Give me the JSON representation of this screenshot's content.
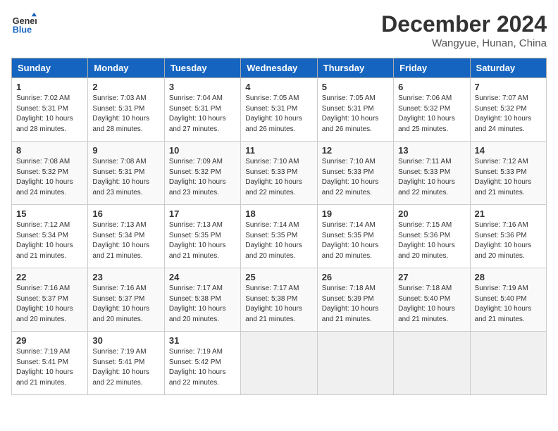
{
  "header": {
    "logo_general": "General",
    "logo_blue": "Blue",
    "month_title": "December 2024",
    "subtitle": "Wangyue, Hunan, China"
  },
  "weekdays": [
    "Sunday",
    "Monday",
    "Tuesday",
    "Wednesday",
    "Thursday",
    "Friday",
    "Saturday"
  ],
  "weeks": [
    [
      {
        "day": "1",
        "sunrise": "7:02 AM",
        "sunset": "5:31 PM",
        "daylight": "10 hours and 28 minutes."
      },
      {
        "day": "2",
        "sunrise": "7:03 AM",
        "sunset": "5:31 PM",
        "daylight": "10 hours and 28 minutes."
      },
      {
        "day": "3",
        "sunrise": "7:04 AM",
        "sunset": "5:31 PM",
        "daylight": "10 hours and 27 minutes."
      },
      {
        "day": "4",
        "sunrise": "7:05 AM",
        "sunset": "5:31 PM",
        "daylight": "10 hours and 26 minutes."
      },
      {
        "day": "5",
        "sunrise": "7:05 AM",
        "sunset": "5:31 PM",
        "daylight": "10 hours and 26 minutes."
      },
      {
        "day": "6",
        "sunrise": "7:06 AM",
        "sunset": "5:32 PM",
        "daylight": "10 hours and 25 minutes."
      },
      {
        "day": "7",
        "sunrise": "7:07 AM",
        "sunset": "5:32 PM",
        "daylight": "10 hours and 24 minutes."
      }
    ],
    [
      {
        "day": "8",
        "sunrise": "7:08 AM",
        "sunset": "5:32 PM",
        "daylight": "10 hours and 24 minutes."
      },
      {
        "day": "9",
        "sunrise": "7:08 AM",
        "sunset": "5:31 PM",
        "daylight": "10 hours and 23 minutes."
      },
      {
        "day": "10",
        "sunrise": "7:09 AM",
        "sunset": "5:32 PM",
        "daylight": "10 hours and 23 minutes."
      },
      {
        "day": "11",
        "sunrise": "7:10 AM",
        "sunset": "5:33 PM",
        "daylight": "10 hours and 22 minutes."
      },
      {
        "day": "12",
        "sunrise": "7:10 AM",
        "sunset": "5:33 PM",
        "daylight": "10 hours and 22 minutes."
      },
      {
        "day": "13",
        "sunrise": "7:11 AM",
        "sunset": "5:33 PM",
        "daylight": "10 hours and 22 minutes."
      },
      {
        "day": "14",
        "sunrise": "7:12 AM",
        "sunset": "5:33 PM",
        "daylight": "10 hours and 21 minutes."
      }
    ],
    [
      {
        "day": "15",
        "sunrise": "7:12 AM",
        "sunset": "5:34 PM",
        "daylight": "10 hours and 21 minutes."
      },
      {
        "day": "16",
        "sunrise": "7:13 AM",
        "sunset": "5:34 PM",
        "daylight": "10 hours and 21 minutes."
      },
      {
        "day": "17",
        "sunrise": "7:13 AM",
        "sunset": "5:35 PM",
        "daylight": "10 hours and 21 minutes."
      },
      {
        "day": "18",
        "sunrise": "7:14 AM",
        "sunset": "5:35 PM",
        "daylight": "10 hours and 20 minutes."
      },
      {
        "day": "19",
        "sunrise": "7:14 AM",
        "sunset": "5:35 PM",
        "daylight": "10 hours and 20 minutes."
      },
      {
        "day": "20",
        "sunrise": "7:15 AM",
        "sunset": "5:36 PM",
        "daylight": "10 hours and 20 minutes."
      },
      {
        "day": "21",
        "sunrise": "7:16 AM",
        "sunset": "5:36 PM",
        "daylight": "10 hours and 20 minutes."
      }
    ],
    [
      {
        "day": "22",
        "sunrise": "7:16 AM",
        "sunset": "5:37 PM",
        "daylight": "10 hours and 20 minutes."
      },
      {
        "day": "23",
        "sunrise": "7:16 AM",
        "sunset": "5:37 PM",
        "daylight": "10 hours and 20 minutes."
      },
      {
        "day": "24",
        "sunrise": "7:17 AM",
        "sunset": "5:38 PM",
        "daylight": "10 hours and 20 minutes."
      },
      {
        "day": "25",
        "sunrise": "7:17 AM",
        "sunset": "5:38 PM",
        "daylight": "10 hours and 21 minutes."
      },
      {
        "day": "26",
        "sunrise": "7:18 AM",
        "sunset": "5:39 PM",
        "daylight": "10 hours and 21 minutes."
      },
      {
        "day": "27",
        "sunrise": "7:18 AM",
        "sunset": "5:40 PM",
        "daylight": "10 hours and 21 minutes."
      },
      {
        "day": "28",
        "sunrise": "7:19 AM",
        "sunset": "5:40 PM",
        "daylight": "10 hours and 21 minutes."
      }
    ],
    [
      {
        "day": "29",
        "sunrise": "7:19 AM",
        "sunset": "5:41 PM",
        "daylight": "10 hours and 21 minutes."
      },
      {
        "day": "30",
        "sunrise": "7:19 AM",
        "sunset": "5:41 PM",
        "daylight": "10 hours and 22 minutes."
      },
      {
        "day": "31",
        "sunrise": "7:19 AM",
        "sunset": "5:42 PM",
        "daylight": "10 hours and 22 minutes."
      },
      null,
      null,
      null,
      null
    ]
  ]
}
